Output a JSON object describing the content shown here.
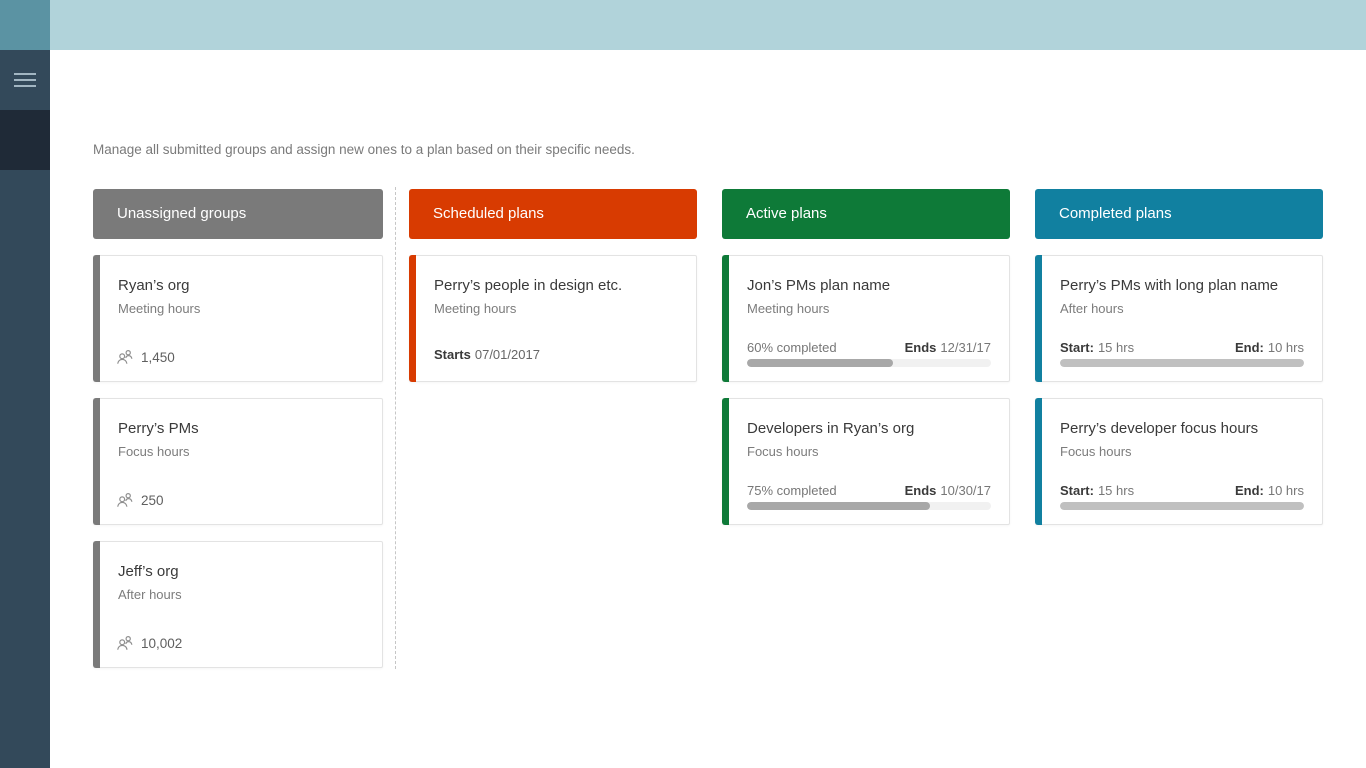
{
  "app": {
    "tile_color": "#5b93a3",
    "topbar_color": "#b1d3da",
    "sidebar_color": "#33495a",
    "sidebar_selected_color": "#1f2a37",
    "menu_icon": "hamburger-menu"
  },
  "page": {
    "description": "Manage all submitted groups and assign new ones to a plan based on their specific needs."
  },
  "board": {
    "columns": [
      {
        "title": "Unassigned groups",
        "color": "#7a7a7a",
        "cards": [
          {
            "title": "Ryan’s org",
            "subtitle": "Meeting hours",
            "icon": "people-icon",
            "member_count": "1,450"
          },
          {
            "title": "Perry’s PMs",
            "subtitle": "Focus hours",
            "icon": "people-icon",
            "member_count": "250"
          },
          {
            "title": "Jeff’s org",
            "subtitle": "After hours",
            "icon": "people-icon",
            "member_count": "10,002"
          }
        ]
      },
      {
        "title": "Scheduled plans",
        "color": "#d83b01",
        "cards": [
          {
            "title": "Perry’s people in design etc.",
            "subtitle": "Meeting hours",
            "starts_label": "Starts",
            "starts_date": "07/01/2017"
          }
        ]
      },
      {
        "title": "Active plans",
        "color": "#0e7a38",
        "cards": [
          {
            "title": "Jon’s PMs plan name",
            "subtitle": "Meeting hours",
            "progress_label": "60% completed",
            "progress": "60%",
            "ends_label": "Ends",
            "ends_date": "12/31/17"
          },
          {
            "title": "Developers in Ryan’s org",
            "subtitle": "Focus hours",
            "progress_label": "75% completed",
            "progress": "75%",
            "ends_label": "Ends",
            "ends_date": "10/30/17"
          }
        ]
      },
      {
        "title": "Completed plans",
        "color": "#1180a0",
        "cards": [
          {
            "title": "Perry’s PMs with long plan name",
            "subtitle": "After hours",
            "start_label": "Start:",
            "start_value": "15 hrs",
            "end_label": "End:",
            "end_value": "10 hrs",
            "progress": "100%"
          },
          {
            "title": "Perry’s developer focus hours",
            "subtitle": "Focus hours",
            "start_label": "Start:",
            "start_value": "15 hrs",
            "end_label": "End:",
            "end_value": "10 hrs",
            "progress": "100%"
          }
        ]
      }
    ]
  }
}
